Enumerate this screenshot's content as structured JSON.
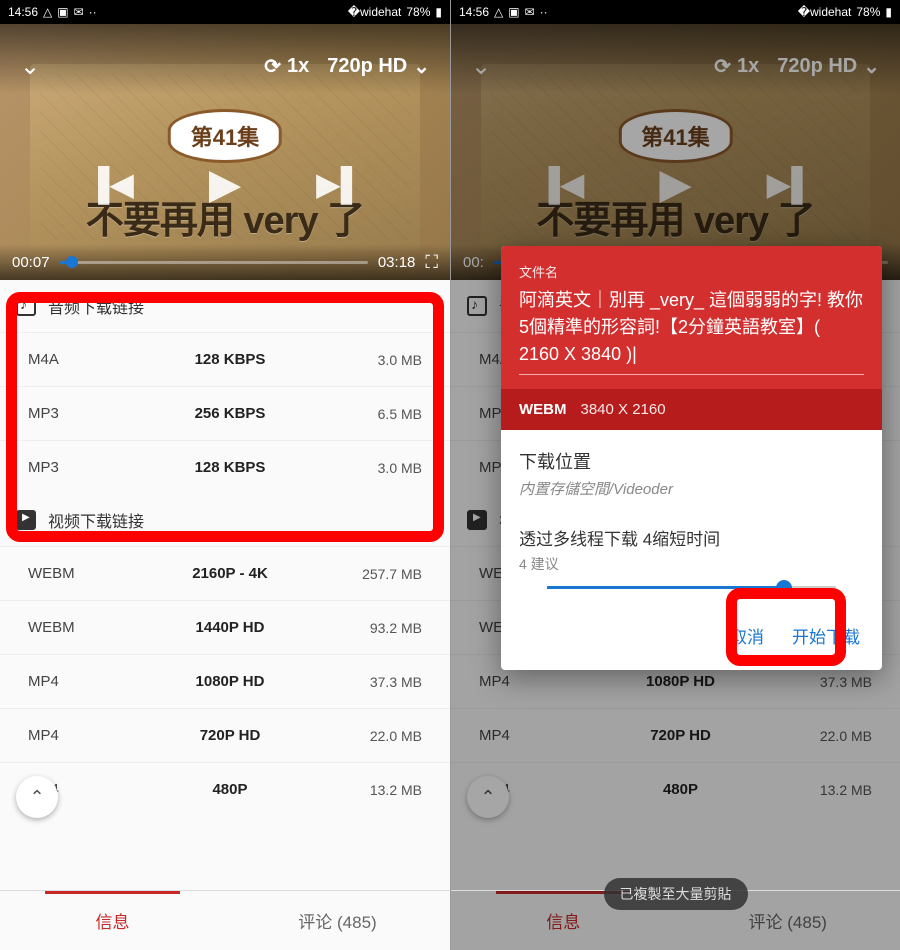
{
  "status": {
    "time": "14:56",
    "battery": "78%"
  },
  "player": {
    "badge": "第41集",
    "title": "不要再用 very 了",
    "speed": "1x",
    "quality": "720p HD",
    "current_time": "00:07",
    "total_time": "03:18"
  },
  "sections": {
    "audio_header": "音频下载链接",
    "video_header": "视频下载链接"
  },
  "audio_items": [
    {
      "format": "M4A",
      "quality": "128 KBPS",
      "size": "3.0 MB"
    },
    {
      "format": "MP3",
      "quality": "256 KBPS",
      "size": "6.5 MB"
    },
    {
      "format": "MP3",
      "quality": "128 KBPS",
      "size": "3.0 MB"
    }
  ],
  "video_items": [
    {
      "format": "WEBM",
      "quality": "2160P - 4K",
      "size": "257.7 MB"
    },
    {
      "format": "WEBM",
      "quality": "1440P HD",
      "size": "93.2 MB"
    },
    {
      "format": "MP4",
      "quality": "1080P HD",
      "size": "37.3 MB"
    },
    {
      "format": "MP4",
      "quality": "720P HD",
      "size": "22.0 MB"
    },
    {
      "format": "MP4",
      "quality": "480P",
      "size": "13.2 MB"
    }
  ],
  "tabs": {
    "info": "信息",
    "comments": "评论 (485)"
  },
  "dialog": {
    "file_label": "文件名",
    "file_name": "阿滴英文｜別再 _very_ 這個弱弱的字! 教你5個精準的形容詞!【2分鐘英語教室】( 2160 X 3840 )",
    "format": "WEBM",
    "resolution": "3840 X 2160",
    "location_label": "下载位置",
    "location_path": "内置存儲空間/Videoder",
    "thread_label": "透过多线程下载 4缩短时间",
    "thread_sub": "4 建议",
    "cancel": "取消",
    "start": "开始下载"
  },
  "toast": "已複製至大量剪貼"
}
